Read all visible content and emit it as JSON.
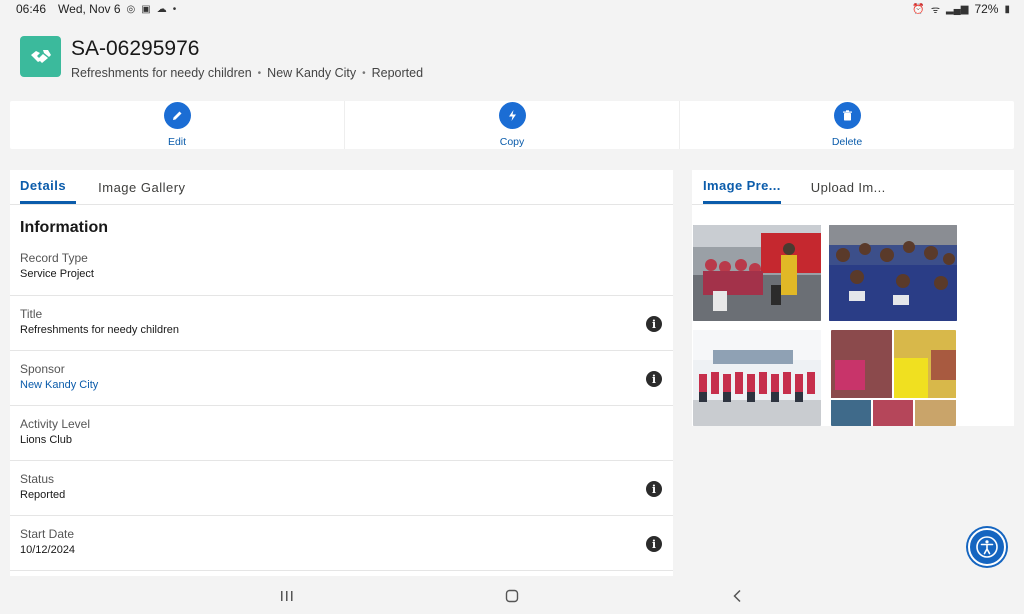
{
  "status_bar": {
    "time": "06:46",
    "date": "Wed, Nov 6",
    "battery": "72%"
  },
  "record": {
    "id": "SA-06295976",
    "subtitle_parts": [
      "Refreshments for needy children",
      "New Kandy City",
      "Reported"
    ],
    "icon": "handshake-icon",
    "icon_color": "#3bba9c"
  },
  "actions": [
    {
      "label": "Edit",
      "icon": "pencil-icon"
    },
    {
      "label": "Copy",
      "icon": "bolt-icon"
    },
    {
      "label": "Delete",
      "icon": "trash-icon"
    }
  ],
  "left_tabs": [
    {
      "label": "Details",
      "active": true
    },
    {
      "label": "Image Gallery",
      "active": false
    }
  ],
  "section_title": "Information",
  "fields": [
    {
      "label": "Record Type",
      "value": "Service Project",
      "link": false,
      "info": false
    },
    {
      "label": "Title",
      "value": "Refreshments for needy children",
      "link": false,
      "info": true
    },
    {
      "label": "Sponsor",
      "value": "New Kandy City",
      "link": true,
      "info": true
    },
    {
      "label": "Activity Level",
      "value": "Lions Club",
      "link": false,
      "info": false
    },
    {
      "label": "Status",
      "value": "Reported",
      "link": false,
      "info": true
    },
    {
      "label": "Start Date",
      "value": "10/12/2024",
      "link": false,
      "info": true
    }
  ],
  "right_tabs": [
    {
      "label": "Image Pre...",
      "active": true
    },
    {
      "label": "Upload Im...",
      "active": false
    }
  ],
  "colors": {
    "accent": "#0b5cab",
    "action_circle": "#1b6dd4",
    "fab": "#1565c0"
  }
}
